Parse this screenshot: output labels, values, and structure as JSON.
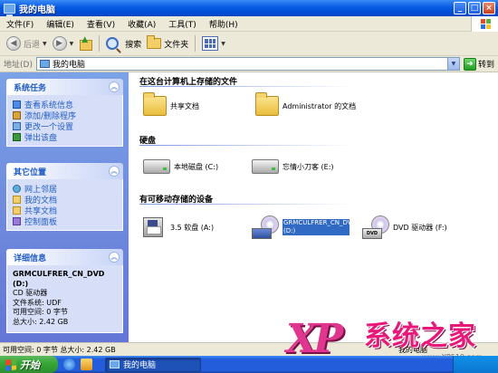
{
  "window": {
    "title": "我的电脑",
    "buttons": {
      "minimize": "_",
      "maximize": "□",
      "close": "×"
    }
  },
  "menu": [
    "文件(F)",
    "编辑(E)",
    "查看(V)",
    "收藏(A)",
    "工具(T)",
    "帮助(H)"
  ],
  "toolbar": {
    "back_label": "后退",
    "search_label": "搜索",
    "folders_label": "文件夹"
  },
  "address": {
    "label": "地址(D)",
    "value": "我的电脑",
    "go_label": "转到"
  },
  "tasks": {
    "system": {
      "title": "系统任务",
      "items": [
        "查看系统信息",
        "添加/删除程序",
        "更改一个设置",
        "弹出该盘"
      ]
    },
    "places": {
      "title": "其它位置",
      "items": [
        "网上邻居",
        "我的文档",
        "共享文档",
        "控制面板"
      ]
    },
    "details": {
      "title": "详细信息",
      "name": "GRMCULFRER_CN_DVD (D:)",
      "type": "CD 驱动器",
      "filesystem": "文件系统: UDF",
      "free": "可用空间: 0 字节",
      "total": "总大小: 2.42 GB"
    }
  },
  "main": {
    "files_section": "在这台计算机上存储的文件",
    "shared_docs": "共享文档",
    "admin_docs": "Administrator 的文档",
    "disk_section": "硬盘",
    "drive_c": "本地磁盘 (C:)",
    "drive_e": "忘情小刀客 (E:)",
    "removable_section": "有可移动存储的设备",
    "floppy": "3.5 软盘 (A:)",
    "dvd_d": "GRMCULFRER_CN_DVD (D:)",
    "dvd_f": "DVD 驱动器 (F:)"
  },
  "status": {
    "text": "可用空间: 0 字节 总大小: 2.42 GB",
    "location": "我的电脑"
  },
  "taskbar": {
    "start_label": "开始",
    "task_label": "我的电脑"
  },
  "watermark": {
    "brand": "XP",
    "text": "系统之家",
    "url": "www.XP510.com"
  },
  "colors": {
    "title_bar": "#0050d8",
    "task_pane": "#6f8ae0",
    "link": "#215dc6",
    "selection": "#316ac5",
    "watermark": "#e8187a"
  }
}
